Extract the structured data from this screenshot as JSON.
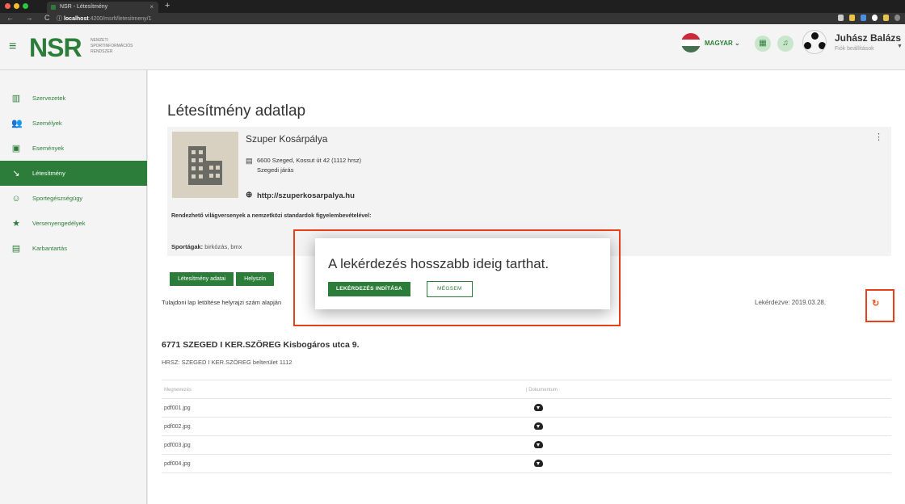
{
  "browser": {
    "tab_title": "NSR - Létesítmény",
    "tab_close": "×",
    "new_tab": "+",
    "nav": "← → C",
    "url_host": "localhost",
    "url_path": ":4200/msrlt/letesitmeny/1"
  },
  "header": {
    "hamburger": "≡",
    "logo": "NSR",
    "logo_sub": "NEMZETI SPORTINFORMÁCIÓS RENDSZER",
    "language": "MAGYAR ⌄",
    "user_name": "Juhász Balázs",
    "user_sub": "Fiók beállítások"
  },
  "sidebar": {
    "items": [
      {
        "label": "Szervezetek",
        "icon": "▥"
      },
      {
        "label": "Személyek",
        "icon": "👥"
      },
      {
        "label": "Események",
        "icon": "▣"
      },
      {
        "label": "Létesítmény",
        "icon": "↘"
      },
      {
        "label": "Sportegészségügy",
        "icon": "☺"
      },
      {
        "label": "Versenyengedélyek",
        "icon": "★"
      },
      {
        "label": "Karbantartás",
        "icon": "▤"
      }
    ]
  },
  "main": {
    "page_title": "Létesítmény adatlap",
    "facility_name": "Szuper Kosárpálya",
    "address_line1": "6600 Szeged, Kossut út 42 (1112 hrsz)",
    "address_line2": "Szegedi járás",
    "website": "http://szuperkosarpalya.hu",
    "rendezheto": "Rendezhető világversenyek a nemzetközi standardok figyelembevételével:",
    "sport_label": "Sportágak:",
    "sport_value": " birkózás, bmx",
    "tabs": [
      "Létesítmény adatai",
      "Helyszín"
    ],
    "tulajdoni": "Tulajdoni lap letöltése helyrajzi szám alapján",
    "lekerdezve": "Lekérdezve: 2019.03.28.",
    "address_title": "6771 SZEGED I KER.SZÖREG Kisbogáros utca 9.",
    "hrsz": "HRSZ: SZEGED I KER.SZÖREG belterület 1112",
    "table_headers": [
      "Megnevezés",
      "| Dokumentum"
    ],
    "table_rows": [
      "pdf001.jpg",
      "pdf002.jpg",
      "pdf003.jpg",
      "pdf004.jpg"
    ]
  },
  "dialog": {
    "message": "A lekérdezés hosszabb ideig tarthat.",
    "start_button": "LEKÉRDEZÉS INDÍTÁSA",
    "cancel_button": "MÉGSEM"
  },
  "colors": {
    "brand_green": "#2d7d3a",
    "highlight_red": "#e8401a"
  }
}
